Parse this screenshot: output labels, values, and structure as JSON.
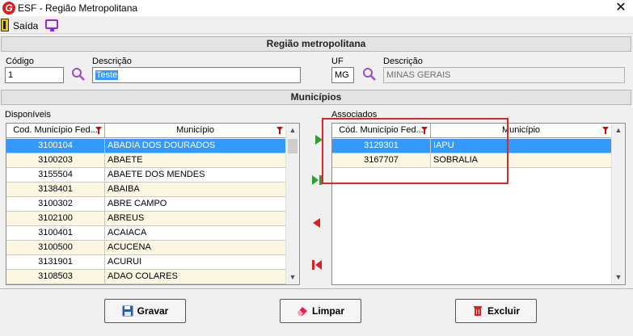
{
  "window": {
    "title": "ESF - Região Metropolitana",
    "app_icon": "G"
  },
  "toolbar": {
    "exit_label": "Saída"
  },
  "region_section": {
    "title": "Região metropolitana"
  },
  "fields": {
    "codigo_label": "Código",
    "codigo_value": "1",
    "descricao_label": "Descrição",
    "descricao_value": "Teste",
    "uf_label": "UF",
    "uf_value": "MG",
    "uf_descricao_label": "Descrição",
    "uf_descricao_value": "MINAS GERAIS"
  },
  "municipios_section": {
    "title": "Municípios"
  },
  "disponiveis": {
    "label": "Disponíveis",
    "columns": [
      "Cod. Município Fed...",
      "Município"
    ],
    "rows": [
      {
        "code": "3100104",
        "name": "ABADIA DOS DOURADOS",
        "selected": true
      },
      {
        "code": "3100203",
        "name": "ABAETE"
      },
      {
        "code": "3155504",
        "name": "ABAETE DOS MENDES"
      },
      {
        "code": "3138401",
        "name": "ABAIBA"
      },
      {
        "code": "3100302",
        "name": "ABRE CAMPO"
      },
      {
        "code": "3102100",
        "name": "ABREUS"
      },
      {
        "code": "3100401",
        "name": "ACAIACA"
      },
      {
        "code": "3100500",
        "name": "ACUCENA"
      },
      {
        "code": "3131901",
        "name": "ACURUI"
      },
      {
        "code": "3108503",
        "name": "ADAO COLARES"
      }
    ]
  },
  "associados": {
    "label": "Associados",
    "columns": [
      "Cód. Município Fed...",
      "Município"
    ],
    "rows": [
      {
        "code": "3129301",
        "name": "IAPU",
        "selected": true
      },
      {
        "code": "3167707",
        "name": "SOBRALIA"
      }
    ]
  },
  "buttons": {
    "save": "Gravar",
    "clear": "Limpar",
    "delete": "Excluir"
  },
  "colors": {
    "selection": "#3399ff",
    "filter": "#e00000",
    "highlight_box": "#d42a2a",
    "add_arrow": "#2e9e2e",
    "remove_arrow": "#e02020"
  },
  "icons": [
    "app-logo-icon",
    "exit-door-icon",
    "screen-icon",
    "search-icon",
    "filter-icon",
    "add-arrow-icon",
    "add-all-arrow-icon",
    "remove-arrow-icon",
    "remove-all-arrow-icon",
    "save-disk-icon",
    "eraser-icon",
    "trash-icon"
  ]
}
